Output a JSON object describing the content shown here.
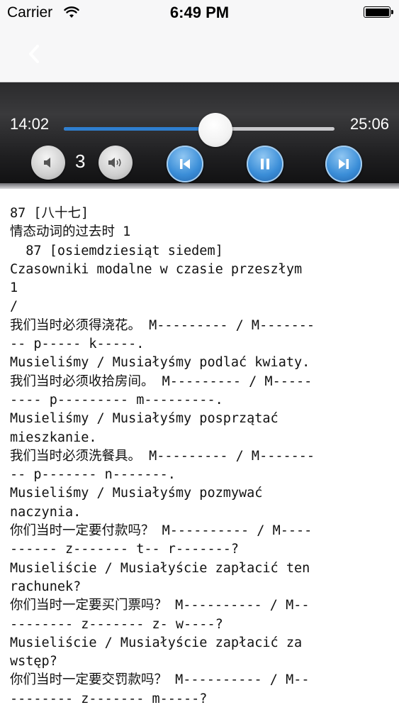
{
  "status_bar": {
    "carrier": "Carrier",
    "time": "6:49 PM"
  },
  "nav": {
    "back_icon": "chevron-left-icon"
  },
  "player": {
    "elapsed": "14:02",
    "total": "25:06",
    "progress": 0.559,
    "volume_level": "3",
    "accent_color": "#2f7fd0"
  },
  "content_lines": [
    "87 [八十七]",
    "情态动词的过去时 1",
    "  87 [osiemdziesiąt siedem]",
    "Czasowniki modalne w czasie przeszłym",
    "1",
    "/",
    "我们当时必须得浇花。 M--------- / M-------",
    "-- p----- k-----.",
    "Musieliśmy / Musiałyśmy podlać kwiaty.",
    "我们当时必须收拾房间。 M--------- / M-----",
    "---- p--------- m---------.",
    "Musieliśmy / Musiałyśmy posprzątać",
    "mieszkanie.",
    "我们当时必须洗餐具。 M--------- / M-------",
    "-- p------- n-------.",
    "Musieliśmy / Musiałyśmy pozmywać",
    "naczynia.",
    "你们当时一定要付款吗？ M---------- / M----",
    "------ z------- t-- r-------?",
    "Musieliście / Musiałyście zapłacić ten",
    "rachunek?",
    "你们当时一定要买门票吗？ M---------- / M--",
    "-------- z------- z- w----?",
    "Musieliście / Musiałyście zapłacić za",
    "wstęp?",
    "你们当时一定要交罚款吗？ M---------- / M--",
    "-------- z------- m-----?"
  ]
}
